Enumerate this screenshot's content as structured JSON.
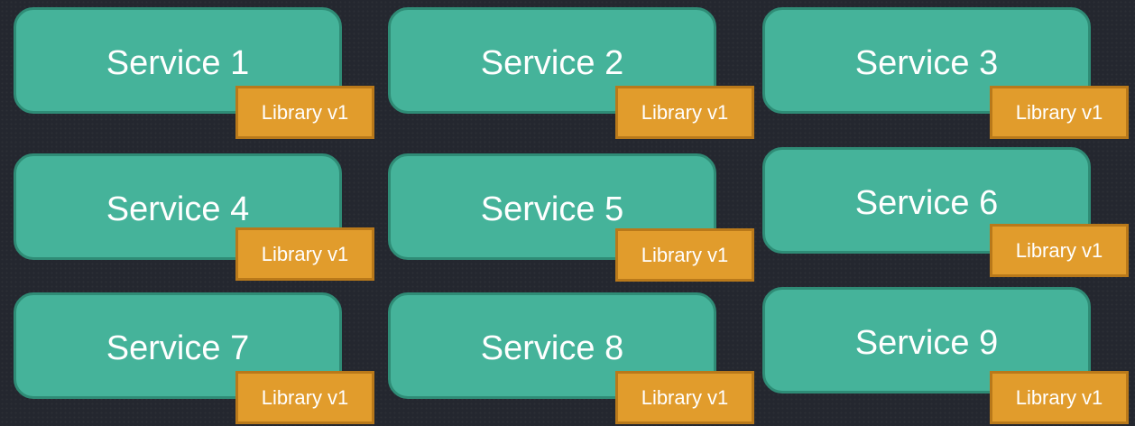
{
  "services": [
    {
      "label": "Service 1",
      "library": "Library v1"
    },
    {
      "label": "Service 2",
      "library": "Library v1"
    },
    {
      "label": "Service 3",
      "library": "Library v1"
    },
    {
      "label": "Service 4",
      "library": "Library v1"
    },
    {
      "label": "Service 5",
      "library": "Library v1"
    },
    {
      "label": "Service 6",
      "library": "Library v1"
    },
    {
      "label": "Service 7",
      "library": "Library v1"
    },
    {
      "label": "Service 8",
      "library": "Library v1"
    },
    {
      "label": "Service 9",
      "library": "Library v1"
    }
  ],
  "colors": {
    "background": "#24272f",
    "service_fill": "#45b39a",
    "service_border": "#2f8c76",
    "library_fill": "#e19c2c",
    "library_border": "#b9791a",
    "text": "#ffffff"
  }
}
